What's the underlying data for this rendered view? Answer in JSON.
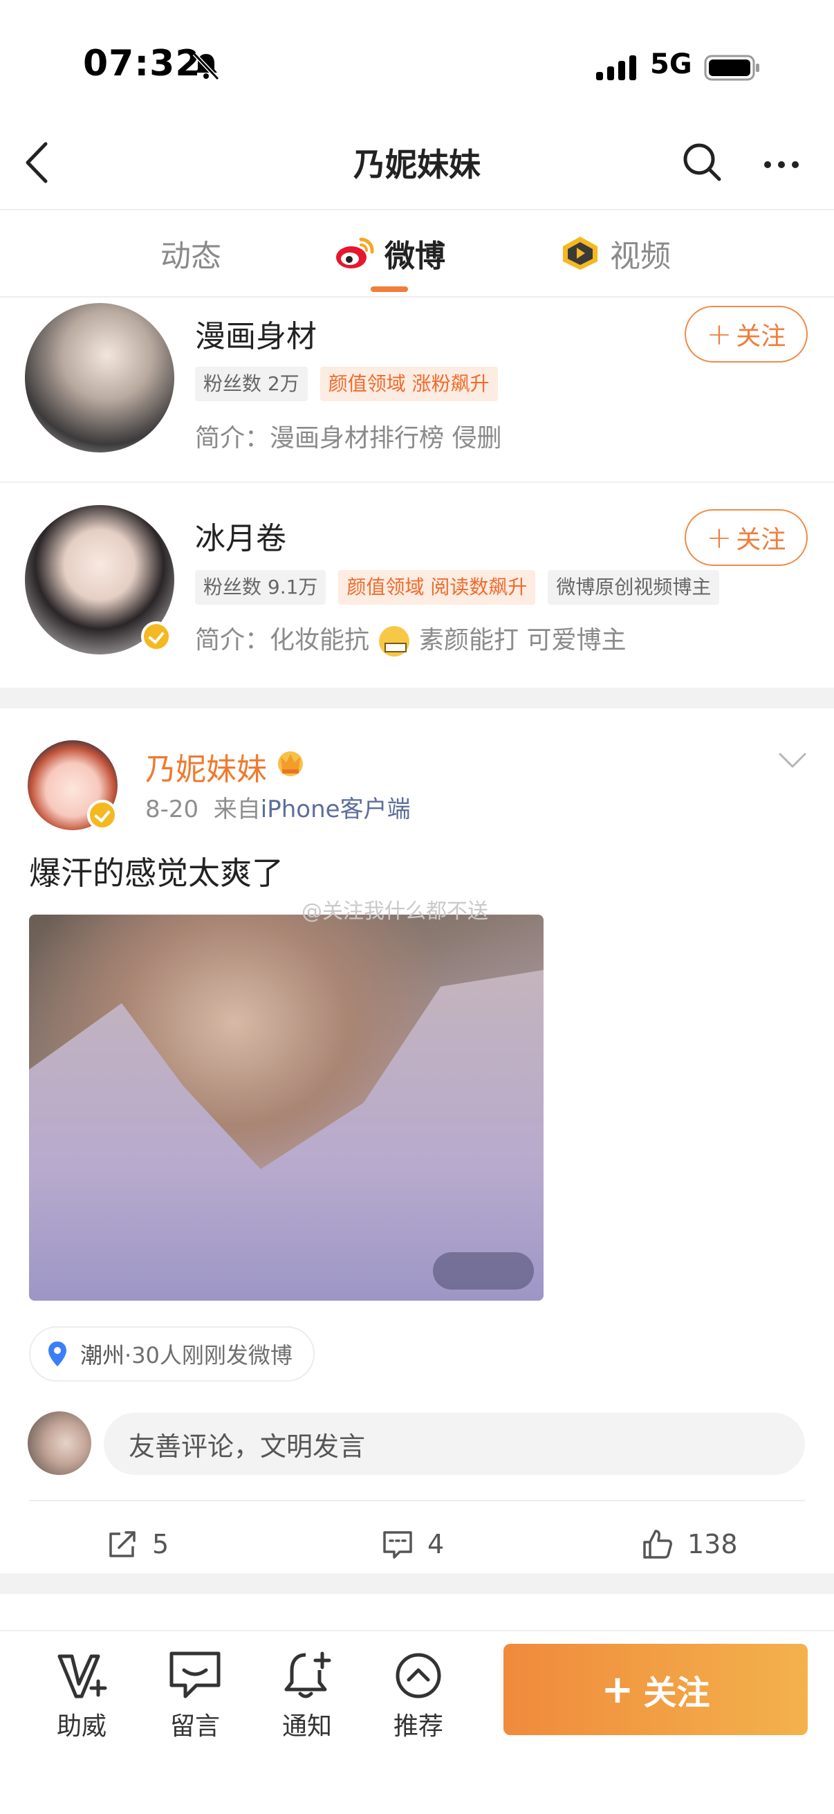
{
  "status_bar": {
    "time": "07:32",
    "network": "5G"
  },
  "nav": {
    "title": "乃妮妹妹"
  },
  "tabs": [
    {
      "label": "动态",
      "active": false
    },
    {
      "label": "微博",
      "active": true
    },
    {
      "label": "视频",
      "active": false
    }
  ],
  "recommended_users": [
    {
      "name": "漫画身材",
      "tags": [
        "粉丝数 2万",
        "颜值领域 涨粉飙升"
      ],
      "bio": "简介：漫画身材排行榜 侵删",
      "verified": false,
      "follow_label": "关注"
    },
    {
      "name": "冰月卷",
      "tags": [
        "粉丝数 9.1万",
        "颜值领域 阅读数飙升",
        "微博原创视频博主"
      ],
      "bio_before": "简介：化妆能抗",
      "bio_after": "素颜能打 可爱博主",
      "verified": true,
      "follow_label": "关注"
    }
  ],
  "post": {
    "author": "乃妮妹妹",
    "date": "8-20",
    "from_label": "来自",
    "source": "iPhone客户端",
    "text": "爆汗的感觉太爽了",
    "watermark": "@关注我什么都不送",
    "location_name": "潮州",
    "location_suffix": "·30人刚刚发微博",
    "comment_placeholder": "友善评论，文明发言",
    "reposts": "5",
    "comments": "4",
    "likes": "138"
  },
  "bottom_bar": {
    "items": [
      "助威",
      "留言",
      "通知",
      "推荐"
    ],
    "follow_label": "关注"
  },
  "colors": {
    "accent": "#f07d3a",
    "verified": "#f5b820",
    "link": "#5b6e9a"
  }
}
